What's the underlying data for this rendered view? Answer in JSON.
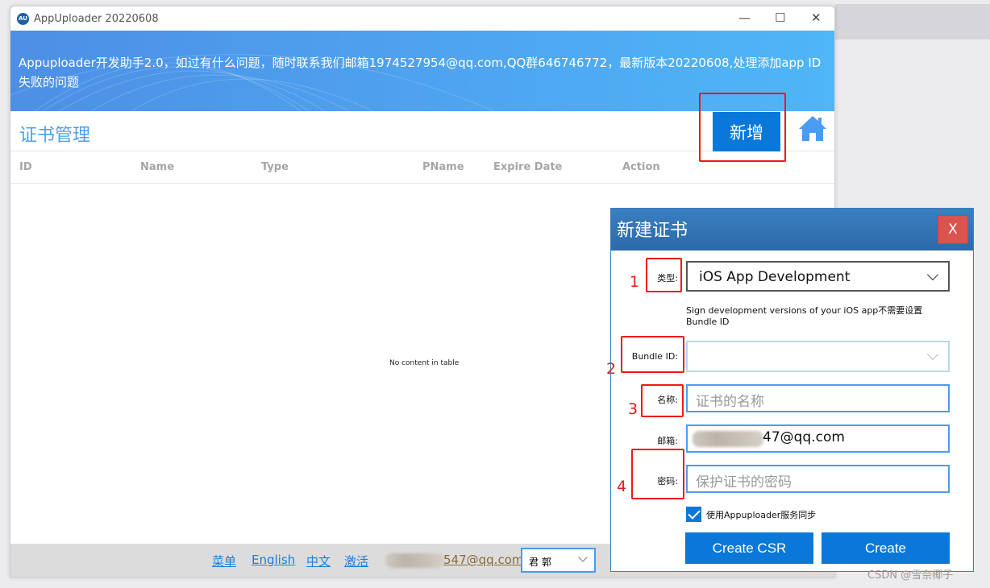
{
  "window": {
    "title": "AppUploader 20220608",
    "logo_text": "AU",
    "minimize": "—",
    "maximize": "☐",
    "close": "✕"
  },
  "banner": {
    "text": "Appuploader开发助手2.0，如过有什么问题，随时联系我们邮箱1974527954@qq.com,QQ群646746772，最新版本20220608,处理添加app ID失败的问题"
  },
  "page": {
    "title": "证书管理",
    "add_label": "新增",
    "home_icon": "home-icon"
  },
  "table": {
    "columns": [
      "ID",
      "Name",
      "Type",
      "PName",
      "Expire Date",
      "Action"
    ],
    "rows": [],
    "empty_text": "No content in table"
  },
  "footer": {
    "links": [
      "菜单",
      "English",
      "中文",
      "激活"
    ],
    "email_visible": "547@qq.com",
    "select_value": "君 郭"
  },
  "dialog": {
    "title": "新建证书",
    "close_label": "X",
    "type_label": "类型:",
    "type_value": "iOS App Development",
    "type_hint": "Sign development versions of your iOS app不需要设置Bundle ID",
    "bundle_label": "Bundle ID:",
    "bundle_value": "",
    "name_label": "名称:",
    "name_placeholder": "证书的名称",
    "email_label": "邮箱:",
    "email_visible": "47@qq.com",
    "password_label": "密码:",
    "password_placeholder": "保护证书的密码",
    "sync_label": "使用Appuploader服务同步",
    "sync_checked": true,
    "create_csr_label": "Create CSR",
    "create_label": "Create"
  },
  "annotations": [
    "1",
    "2",
    "3",
    "4"
  ],
  "watermark": "CSDN @雪奈椰子",
  "colors": {
    "accent": "#0a78d8",
    "banner_start": "#4d8fe6",
    "banner_end": "#4fb6f8",
    "annotation": "#f01818",
    "close": "#d9534f"
  }
}
